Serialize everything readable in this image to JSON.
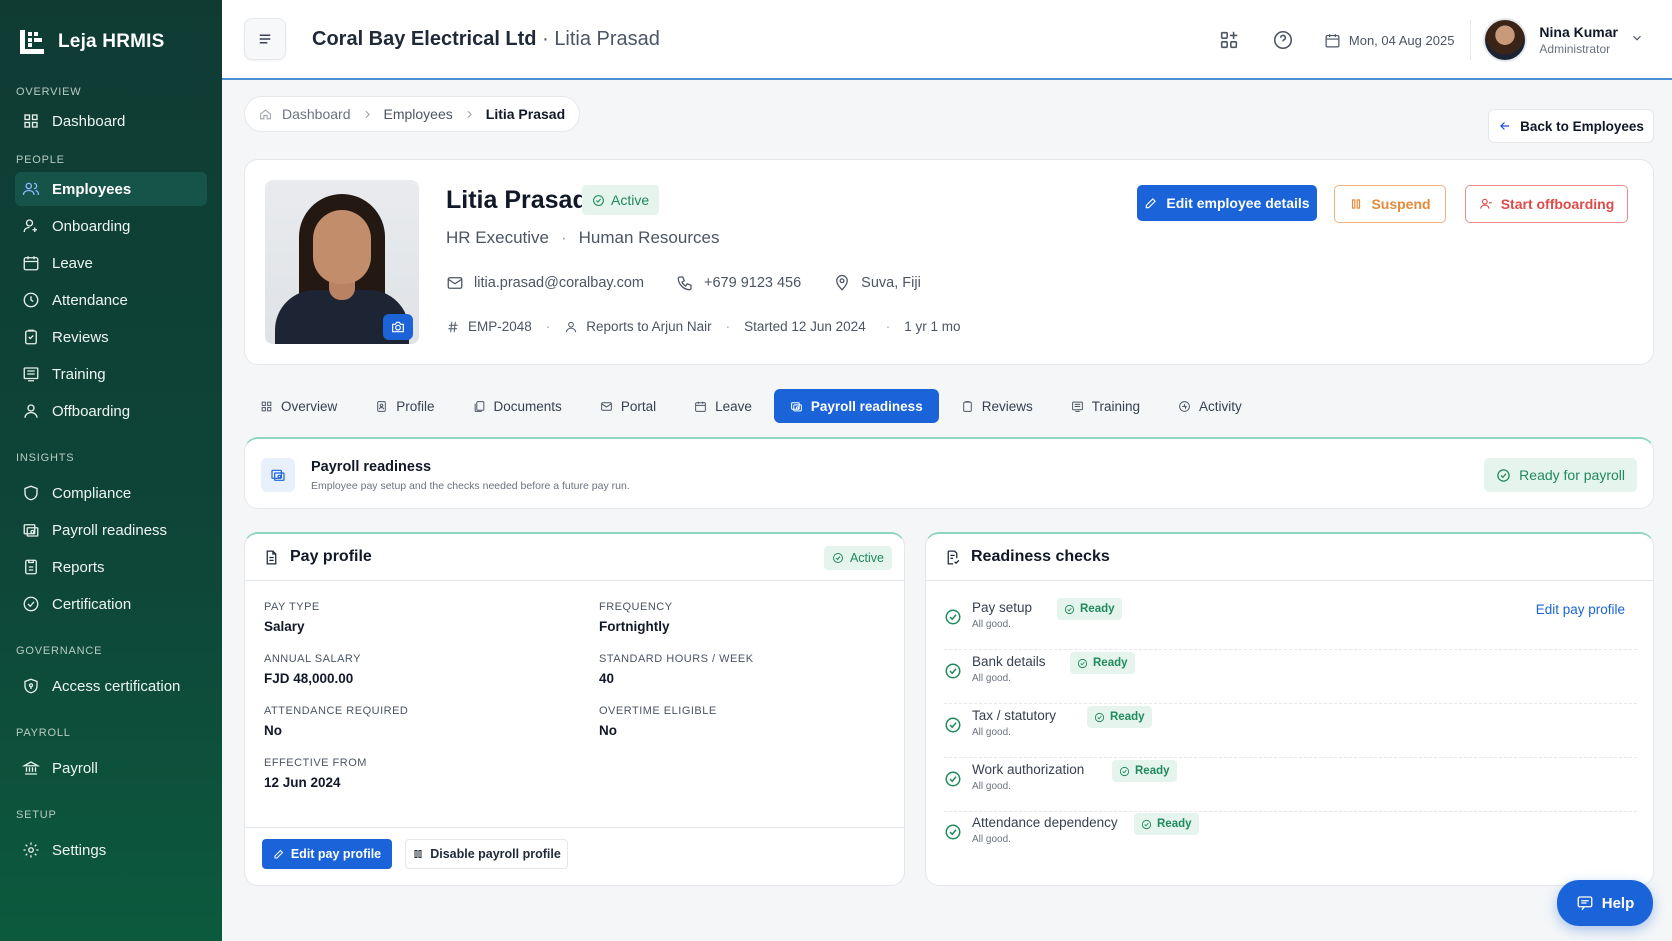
{
  "brand": {
    "name": "Leja HRMIS"
  },
  "sidebar": {
    "sections": [
      {
        "title": "OVERVIEW",
        "items": [
          {
            "label": "Dashboard",
            "icon": "grid-icon"
          }
        ]
      },
      {
        "title": "PEOPLE",
        "items": [
          {
            "label": "Employees",
            "icon": "users-icon",
            "active": true
          },
          {
            "label": "Onboarding",
            "icon": "user-add-icon"
          },
          {
            "label": "Leave",
            "icon": "calendar-icon"
          },
          {
            "label": "Attendance",
            "icon": "clock-icon"
          },
          {
            "label": "Reviews",
            "icon": "clipboard-icon"
          },
          {
            "label": "Training",
            "icon": "book-icon"
          },
          {
            "label": "Offboarding",
            "icon": "user-icon"
          }
        ]
      },
      {
        "title": "INSIGHTS",
        "items": [
          {
            "label": "Compliance",
            "icon": "shield-icon"
          },
          {
            "label": "Payroll readiness",
            "icon": "payroll-icon"
          },
          {
            "label": "Reports",
            "icon": "report-icon"
          },
          {
            "label": "Certification",
            "icon": "badge-icon"
          }
        ]
      },
      {
        "title": "GOVERNANCE",
        "items": [
          {
            "label": "Access certification",
            "icon": "shield-check-icon"
          }
        ]
      },
      {
        "title": "PAYROLL",
        "items": [
          {
            "label": "Payroll",
            "icon": "bank-icon"
          }
        ]
      },
      {
        "title": "SETUP",
        "items": [
          {
            "label": "Settings",
            "icon": "gear-icon"
          }
        ]
      }
    ]
  },
  "topbar": {
    "company": "Coral Bay Electrical Ltd",
    "separator": " · ",
    "employee": "Litia Prasad",
    "date": "Mon, 04 Aug 2025",
    "user_name": "Nina Kumar",
    "user_role": "Administrator"
  },
  "breadcrumb": {
    "home": "Dashboard",
    "section": "Employees",
    "current": "Litia Prasad"
  },
  "back_label": "Back to Employees",
  "profile": {
    "name": "Litia Prasad",
    "status": "Active",
    "title": "HR Executive",
    "department": "Human Resources",
    "email": "litia.prasad@coralbay.com",
    "phone": "+679 9123 456",
    "location": "Suva, Fiji",
    "emp_id": "EMP-2048",
    "reports_to": "Reports to Arjun Nair",
    "started": "Started 12 Jun 2024",
    "tenure": "1 yr 1 mo",
    "actions": {
      "edit": "Edit employee details",
      "suspend": "Suspend",
      "offboard": "Start offboarding"
    }
  },
  "tabs": [
    {
      "label": "Overview",
      "icon": "grid-icon"
    },
    {
      "label": "Profile",
      "icon": "id-icon"
    },
    {
      "label": "Documents",
      "icon": "documents-icon"
    },
    {
      "label": "Portal",
      "icon": "mail-icon"
    },
    {
      "label": "Leave",
      "icon": "calendar-icon"
    },
    {
      "label": "Payroll readiness",
      "icon": "payroll-icon",
      "active": true
    },
    {
      "label": "Reviews",
      "icon": "clipboard-icon"
    },
    {
      "label": "Training",
      "icon": "book-icon"
    },
    {
      "label": "Activity",
      "icon": "activity-icon"
    }
  ],
  "banner": {
    "title": "Payroll readiness",
    "subtitle": "Employee pay setup and the checks needed before a future pay run.",
    "status": "Ready for payroll"
  },
  "pay_profile": {
    "title": "Pay profile",
    "status": "Active",
    "fields": {
      "pay_type": {
        "label": "PAY TYPE",
        "value": "Salary"
      },
      "frequency": {
        "label": "FREQUENCY",
        "value": "Fortnightly"
      },
      "annual_salary": {
        "label": "ANNUAL SALARY",
        "value": "FJD 48,000.00"
      },
      "std_hours": {
        "label": "STANDARD HOURS / WEEK",
        "value": "40"
      },
      "attendance": {
        "label": "ATTENDANCE REQUIRED",
        "value": "No"
      },
      "overtime": {
        "label": "OVERTIME ELIGIBLE",
        "value": "No"
      },
      "effective": {
        "label": "EFFECTIVE FROM",
        "value": "12 Jun 2024"
      }
    },
    "edit_label": "Edit pay profile",
    "disable_label": "Disable payroll profile"
  },
  "checks": {
    "title": "Readiness checks",
    "edit_link": "Edit pay profile",
    "items": [
      {
        "name": "Pay setup",
        "status": "Ready",
        "note": "All good."
      },
      {
        "name": "Bank details",
        "status": "Ready",
        "note": "All good."
      },
      {
        "name": "Tax / statutory",
        "status": "Ready",
        "note": "All good."
      },
      {
        "name": "Work authorization",
        "status": "Ready",
        "note": "All good."
      },
      {
        "name": "Attendance dependency",
        "status": "Ready",
        "note": "All good."
      }
    ]
  },
  "help_label": "Help",
  "colors": {
    "primary": "#1a63d8",
    "success": "#1f8a5b",
    "warning": "#e48a3a",
    "danger": "#df4a4a",
    "sidebar": "#0f3b33"
  }
}
